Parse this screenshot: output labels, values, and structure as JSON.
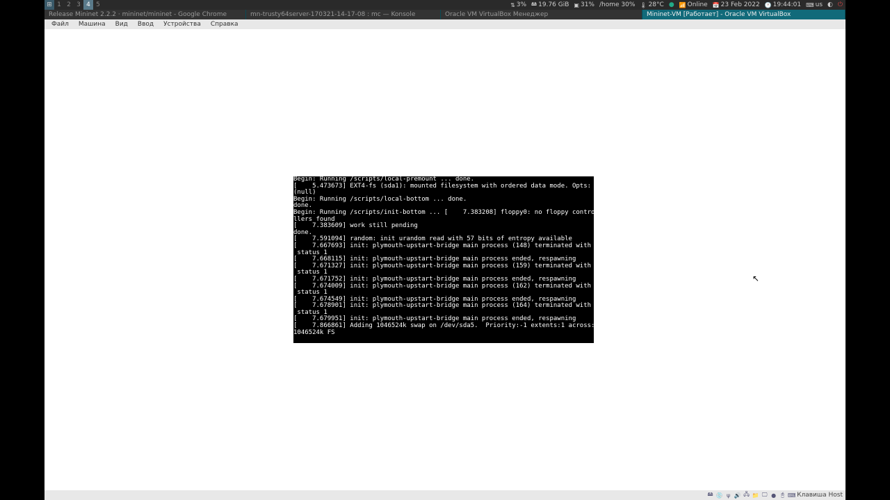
{
  "topbar": {
    "workspaces": [
      "1",
      "2",
      "3",
      "4",
      "5"
    ],
    "active_ws": 3,
    "tray": {
      "net_up": "3%",
      "disk": "19.76 GiB",
      "cpu": "31%",
      "home": "/home 30%",
      "temp": "28°C",
      "online": "Online",
      "date": "23 Feb 2022",
      "time": "19:44:01",
      "kb": "us"
    }
  },
  "titles": {
    "t1": "Release Mininet 2.2.2 · mininet/mininet - Google Chrome",
    "t2": "mn-trusty64server-170321-14-17-08 : mc — Konsole",
    "t3": "Oracle VM VirtualBox Менеджер",
    "t4": "Mininet-VM [Работает] - Oracle VM VirtualBox"
  },
  "menu": {
    "items": [
      "Файл",
      "Машина",
      "Вид",
      "Ввод",
      "Устройства",
      "Справка"
    ]
  },
  "console_text": "Begin: Running /scripts/local-premount ... done.\n[    5.473673] EXT4-fs (sda1): mounted filesystem with ordered data mode. Opts:\n(null)\nBegin: Running /scripts/local-bottom ... done.\ndone.\nBegin: Running /scripts/init-bottom ... [    7.383208] floppy0: no floppy contro\nllers found\n[    7.383609] work still pending\ndone.\n[    7.591094] random: init urandom read with 57 bits of entropy available\n[    7.667693] init: plymouth-upstart-bridge main process (148) terminated with\n status 1\n[    7.668115] init: plymouth-upstart-bridge main process ended, respawning\n[    7.671327] init: plymouth-upstart-bridge main process (159) terminated with\n status 1\n[    7.671752] init: plymouth-upstart-bridge main process ended, respawning\n[    7.674009] init: plymouth-upstart-bridge main process (162) terminated with\n status 1\n[    7.674549] init: plymouth-upstart-bridge main process ended, respawning\n[    7.678901] init: plymouth-upstart-bridge main process (164) terminated with\n status 1\n[    7.679951] init: plymouth-upstart-bridge main process ended, respawning\n[    7.866861] Adding 1046524k swap on /dev/sda5.  Priority:-1 extents:1 across:\n1046524k FS",
  "statusbar": {
    "label": "Клавиша Host"
  }
}
